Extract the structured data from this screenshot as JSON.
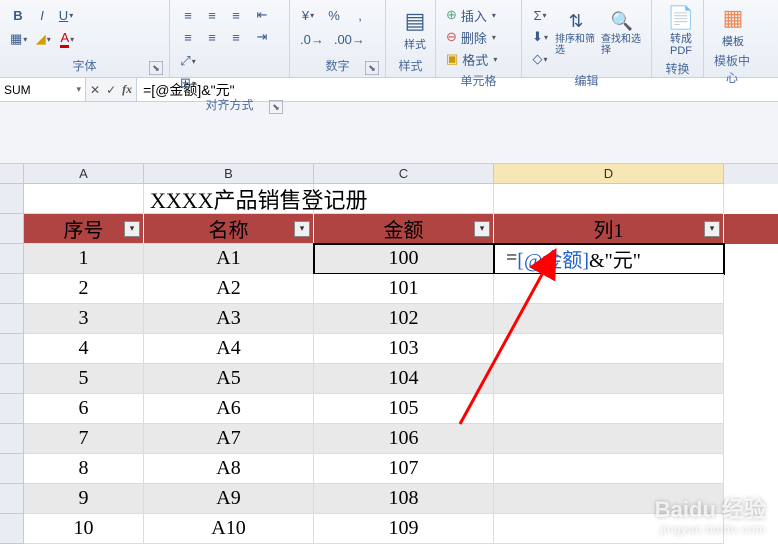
{
  "ribbon": {
    "groups": {
      "font": {
        "label": "字体",
        "bold": "B",
        "italic": "I",
        "underline": "U"
      },
      "align": {
        "label": "对齐方式"
      },
      "number": {
        "label": "数字"
      },
      "styles": {
        "label": "样式",
        "button": "样式"
      },
      "cells": {
        "label": "单元格",
        "insert": "插入",
        "delete": "删除",
        "format": "格式"
      },
      "editing": {
        "label": "编辑",
        "sort": "排序和筛选",
        "find": "查找和选择"
      },
      "convert": {
        "label": "转换",
        "pdf": "转成\nPDF"
      },
      "template": {
        "label": "模板中心",
        "btn": "模板"
      }
    }
  },
  "formula_bar": {
    "namebox": "SUM",
    "cancel": "✕",
    "enter": "✓",
    "fx": "fx",
    "formula": "=[@金额]&\"元\""
  },
  "grid": {
    "columns": [
      "A",
      "B",
      "C",
      "D"
    ],
    "title": "XXXX产品销售登记册",
    "headers": {
      "c1": "序号",
      "c2": "名称",
      "c3": "金额",
      "c4": "列1"
    },
    "editing": {
      "prefix": "=",
      "ref": "[@金额]",
      "suffix": "&\"元\""
    },
    "rows": [
      {
        "n": "1",
        "name": "A1",
        "amt": "100"
      },
      {
        "n": "2",
        "name": "A2",
        "amt": "101"
      },
      {
        "n": "3",
        "name": "A3",
        "amt": "102"
      },
      {
        "n": "4",
        "name": "A4",
        "amt": "103"
      },
      {
        "n": "5",
        "name": "A5",
        "amt": "104"
      },
      {
        "n": "6",
        "name": "A6",
        "amt": "105"
      },
      {
        "n": "7",
        "name": "A7",
        "amt": "106"
      },
      {
        "n": "8",
        "name": "A8",
        "amt": "107"
      },
      {
        "n": "9",
        "name": "A9",
        "amt": "108"
      },
      {
        "n": "10",
        "name": "A10",
        "amt": "109"
      }
    ]
  },
  "watermark": {
    "line1": "Baidu 经验",
    "line2": "jingyan.baidu.com"
  }
}
